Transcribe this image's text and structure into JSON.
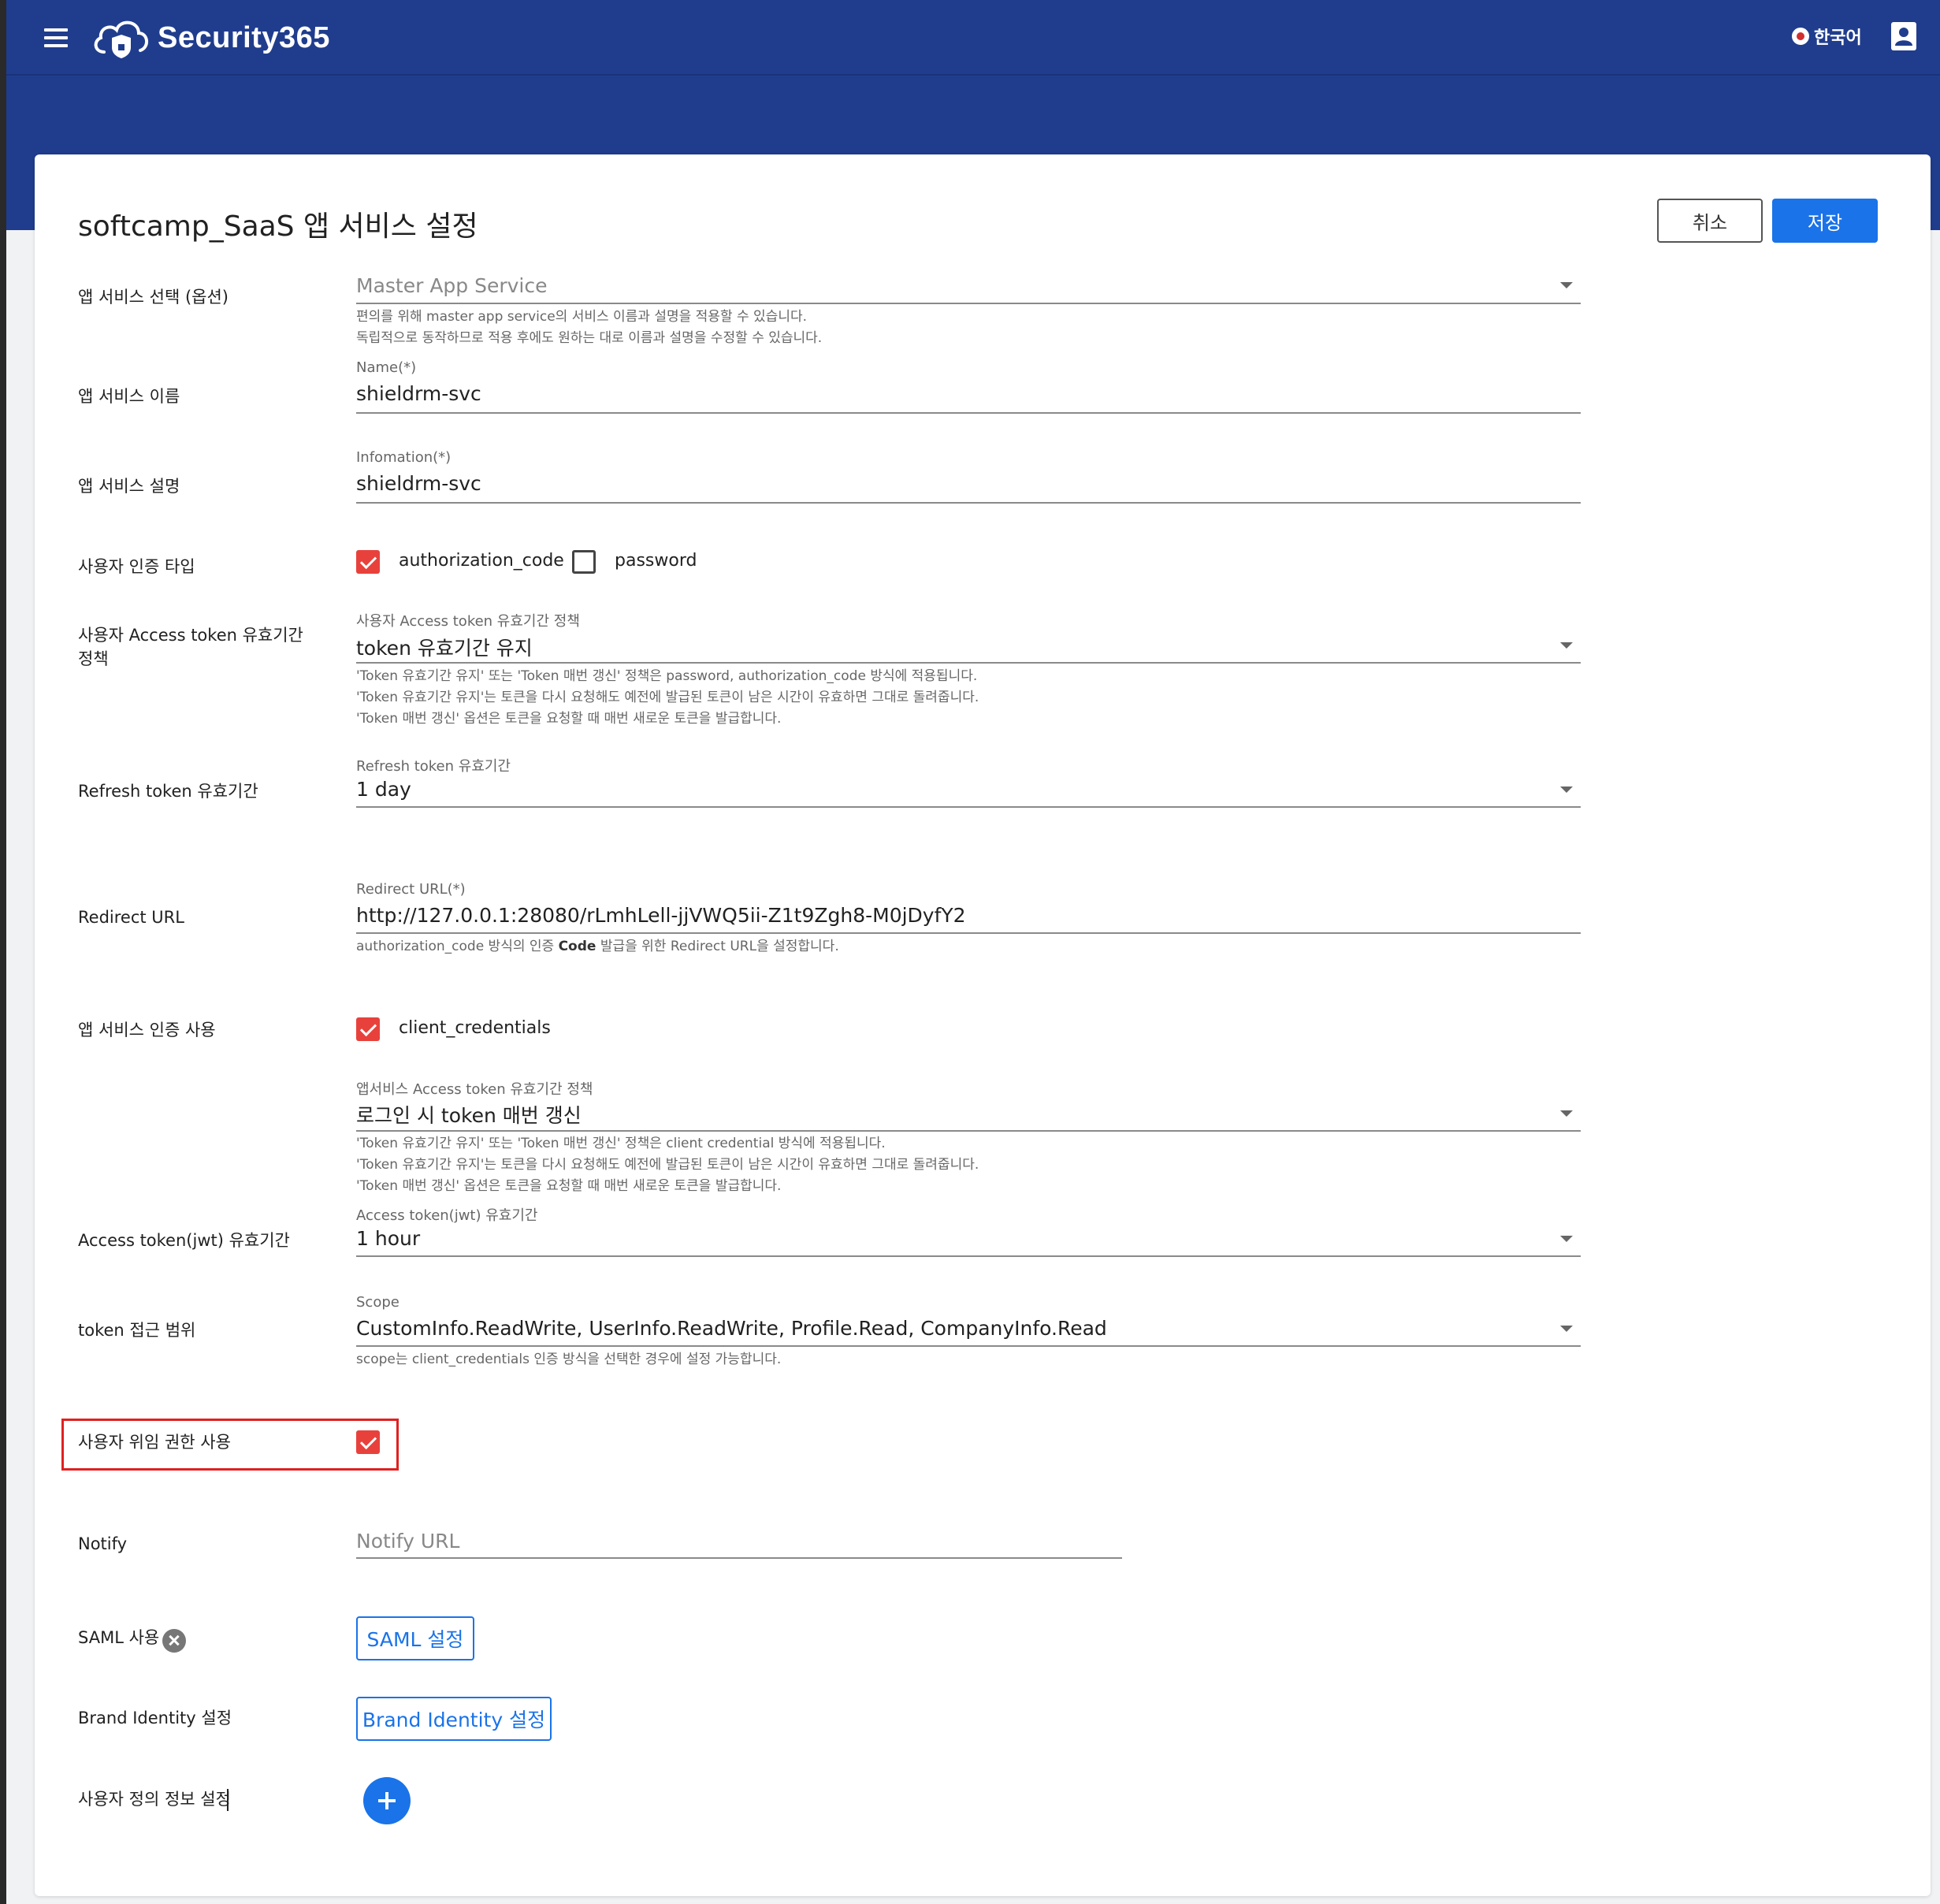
{
  "header": {
    "app_name": "Security365",
    "language": "한국어"
  },
  "page": {
    "title": "softcamp_SaaS 앱 서비스 설정",
    "cancel_label": "취소",
    "save_label": "저장"
  },
  "fields": {
    "app_service_select": {
      "label": "앱 서비스 선택 (옵션)",
      "placeholder": "Master App Service",
      "hint1": "편의를 위해 master app service의 서비스 이름과 설명을 적용할 수 있습니다.",
      "hint2": "독립적으로 동작하므로 적용 후에도 원하는 대로 이름과 설명을 수정할 수 있습니다."
    },
    "app_service_name": {
      "label": "앱 서비스 이름",
      "field_label": "Name(*)",
      "value": "shieldrm-svc"
    },
    "app_service_desc": {
      "label": "앱 서비스 설명",
      "field_label": "Infomation(*)",
      "value": "shieldrm-svc"
    },
    "auth_type": {
      "label": "사용자 인증 타입",
      "option1": "authorization_code",
      "option1_checked": true,
      "option2": "password",
      "option2_checked": false
    },
    "user_token_policy": {
      "label_line1": "사용자 Access token 유효기간",
      "label_line2": "정책",
      "field_label": "사용자 Access token 유효기간 정책",
      "value": "token 유효기간 유지",
      "hint1": "'Token 유효기간 유지' 또는 'Token 매번 갱신' 정책은 password, authorization_code 방식에 적용됩니다.",
      "hint2": "'Token 유효기간 유지'는 토큰을 다시 요청해도 예전에 발급된 토큰이 남은 시간이 유효하면 그대로 돌려줍니다.",
      "hint3": "'Token 매번 갱신' 옵션은 토큰을 요청할 때 매번 새로운 토큰을 발급합니다."
    },
    "refresh_token": {
      "label": "Refresh token 유효기간",
      "field_label": "Refresh token 유효기간",
      "value": "1 day"
    },
    "redirect_url": {
      "label": "Redirect URL",
      "field_label": "Redirect URL(*)",
      "value": "http://127.0.0.1:28080/rLmhLell-jjVWQ5ii-Z1t9Zgh8-M0jDyfY2",
      "hint_pre": "authorization_code 방식의 인증 ",
      "hint_bold": "Code",
      "hint_post": " 발급을 위한 Redirect URL을 설정합니다."
    },
    "app_auth": {
      "label": "앱 서비스 인증 사용",
      "option": "client_credentials",
      "checked": true
    },
    "app_token_policy": {
      "field_label": "앱서비스 Access token 유효기간 정책",
      "value": "로그인 시 token 매번 갱신",
      "hint1": "'Token 유효기간 유지' 또는 'Token 매번 갱신' 정책은 client credential 방식에 적용됩니다.",
      "hint2": "'Token 유효기간 유지'는 토큰을 다시 요청해도 예전에 발급된 토큰이 남은 시간이 유효하면 그대로 돌려줍니다.",
      "hint3": "'Token 매번 갱신' 옵션은 토큰을 요청할 때 매번 새로운 토큰을 발급합니다."
    },
    "access_token_jwt": {
      "label": "Access token(jwt) 유효기간",
      "field_label": "Access token(jwt) 유효기간",
      "value": "1 hour"
    },
    "scope": {
      "label": "token 접근 범위",
      "field_label": "Scope",
      "value": "CustomInfo.ReadWrite, UserInfo.ReadWrite, Profile.Read, CompanyInfo.Read",
      "hint": "scope는 client_credentials 인증 방식을 선택한 경우에 설정 가능합니다."
    },
    "delegation": {
      "label": "사용자 위임 권한 사용",
      "checked": true
    },
    "notify": {
      "label": "Notify",
      "placeholder": "Notify URL"
    },
    "saml": {
      "label": "SAML 사용",
      "button": "SAML 설정"
    },
    "brand_identity": {
      "label": "Brand Identity 설정",
      "button": "Brand Identity 설정"
    },
    "custom_info": {
      "label": "사용자 정의 정보 설정"
    }
  },
  "colors": {
    "header_bg": "#203d8d",
    "primary": "#1a73e8",
    "checkbox": "#e8413c",
    "highlight": "#e02020"
  }
}
